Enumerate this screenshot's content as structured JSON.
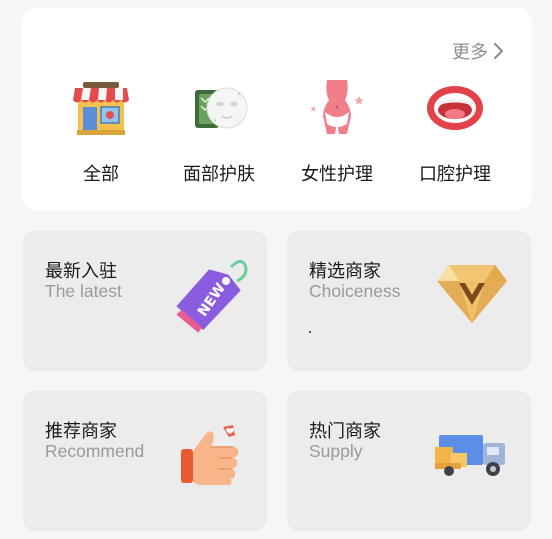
{
  "header": {
    "more_label": "更多"
  },
  "categories": [
    {
      "label": "全部",
      "icon": "storefront-icon"
    },
    {
      "label": "面部护肤",
      "icon": "face-mask-icon"
    },
    {
      "label": "女性护理",
      "icon": "female-body-icon"
    },
    {
      "label": "口腔护理",
      "icon": "mouth-icon"
    }
  ],
  "features": [
    {
      "title": "最新入驻",
      "subtitle": "The latest",
      "icon": "new-tag-icon"
    },
    {
      "title": "精选商家",
      "subtitle": "Choiceness",
      "icon": "diamond-icon"
    },
    {
      "title": "推荐商家",
      "subtitle": "Recommend",
      "icon": "thumbs-up-icon"
    },
    {
      "title": "热门商家",
      "subtitle": "Supply",
      "icon": "delivery-truck-icon"
    }
  ],
  "colors": {
    "page_bg": "#f6f6f6",
    "card_bg": "#ffffff",
    "feature_bg": "#ececec",
    "muted_text": "#9a9a9a"
  }
}
